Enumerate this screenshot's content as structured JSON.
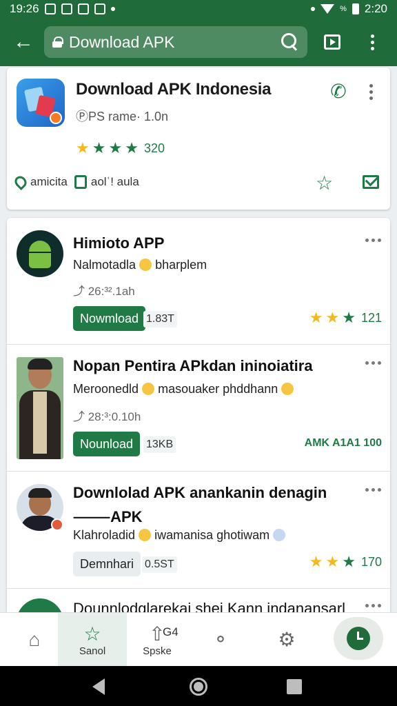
{
  "status_bar": {
    "time_left": "19:26",
    "time_right": "2:20",
    "percent_glyph": "%"
  },
  "toolbar": {
    "search_text": "Download APK"
  },
  "feature": {
    "title": "Download APK Indonesia",
    "subtitle": "ⓅPS rame· 1.0n",
    "rating": "320",
    "action1": "amicita",
    "action2": "aolʿ! aula"
  },
  "items": [
    {
      "title": "Himioto APP",
      "desc_a": "Nalmotadla",
      "desc_b": "bharplem",
      "time": "⤴ 26:³².1ah",
      "button": "Nowmload",
      "size": "1.83T",
      "rating": "121"
    },
    {
      "title": "Nopan Pentira APkdan ininoiatira",
      "desc_a": "Meroonedld",
      "desc_b": "masouaker phddhann",
      "time": "⤴ 28:³:0.10h",
      "button": "Nounload",
      "size": "13KB",
      "rating": "AMK A1A1 100"
    },
    {
      "title_line1": "Downlolad APK anankanin denagin",
      "title_line2": "⸻APK",
      "desc_a": "Klahroladid",
      "desc_b": "iwamanisa ghotiwam",
      "button": "Demnhari",
      "size": "0.5ST",
      "rating": "170"
    },
    {
      "title": "Dounnlodglarekai shei Kann indanansarl"
    }
  ],
  "bottom_nav": {
    "item2_label": "Sanol",
    "item3_label": "Spske",
    "item3_badge": "G4"
  },
  "colors": {
    "primary": "#1f6b3a",
    "accent": "#1f7a45",
    "star": "#f5b91c"
  }
}
